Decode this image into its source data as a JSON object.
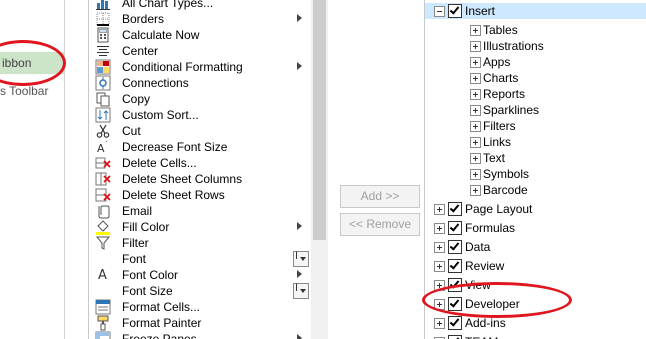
{
  "left_panel": {
    "ribbon_item": "ibbon",
    "toolbar_item": "s Toolbar"
  },
  "commands": [
    {
      "label": "All Chart Types...",
      "icon": "all-chart-types-icon",
      "arrow": false
    },
    {
      "label": "Borders",
      "icon": "borders-icon",
      "arrow": true
    },
    {
      "label": "Calculate Now",
      "icon": "calculator-icon",
      "arrow": false
    },
    {
      "label": "Center",
      "icon": "align-center-icon",
      "arrow": false
    },
    {
      "label": "Conditional Formatting",
      "icon": "conditional-formatting-icon",
      "arrow": true
    },
    {
      "label": "Connections",
      "icon": "connections-icon",
      "arrow": false
    },
    {
      "label": "Copy",
      "icon": "copy-icon",
      "arrow": false
    },
    {
      "label": "Custom Sort...",
      "icon": "custom-sort-icon",
      "arrow": false
    },
    {
      "label": "Cut",
      "icon": "scissors-icon",
      "arrow": false
    },
    {
      "label": "Decrease Font Size",
      "icon": "decrease-font-size-icon",
      "arrow": false
    },
    {
      "label": "Delete Cells...",
      "icon": "delete-cells-icon",
      "arrow": false
    },
    {
      "label": "Delete Sheet Columns",
      "icon": "delete-columns-icon",
      "arrow": false
    },
    {
      "label": "Delete Sheet Rows",
      "icon": "delete-rows-icon",
      "arrow": false
    },
    {
      "label": "Email",
      "icon": "email-icon",
      "arrow": false
    },
    {
      "label": "Fill Color",
      "icon": "fill-color-icon",
      "arrow": true
    },
    {
      "label": "Filter",
      "icon": "filter-icon",
      "arrow": false
    },
    {
      "label": "Font",
      "icon": "",
      "arrow": false,
      "split": true
    },
    {
      "label": "Font Color",
      "icon": "font-color-icon",
      "arrow": true
    },
    {
      "label": "Font Size",
      "icon": "",
      "arrow": false,
      "split": true
    },
    {
      "label": "Format Cells...",
      "icon": "format-cells-icon",
      "arrow": false
    },
    {
      "label": "Format Painter",
      "icon": "format-painter-icon",
      "arrow": false
    },
    {
      "label": "Freeze Panes",
      "icon": "freeze-panes-icon",
      "arrow": true
    }
  ],
  "split_glyph": "I",
  "buttons": {
    "add": "Add >>",
    "remove": "<< Remove"
  },
  "tree": [
    {
      "label": "Insert",
      "level": 0,
      "checkbox": true,
      "expander": "minus"
    },
    {
      "label": "Tables",
      "level": 1,
      "checkbox": false,
      "expander": "plus"
    },
    {
      "label": "Illustrations",
      "level": 1,
      "checkbox": false,
      "expander": "plus"
    },
    {
      "label": "Apps",
      "level": 1,
      "checkbox": false,
      "expander": "plus"
    },
    {
      "label": "Charts",
      "level": 1,
      "checkbox": false,
      "expander": "plus"
    },
    {
      "label": "Reports",
      "level": 1,
      "checkbox": false,
      "expander": "plus"
    },
    {
      "label": "Sparklines",
      "level": 1,
      "checkbox": false,
      "expander": "plus"
    },
    {
      "label": "Filters",
      "level": 1,
      "checkbox": false,
      "expander": "plus"
    },
    {
      "label": "Links",
      "level": 1,
      "checkbox": false,
      "expander": "plus"
    },
    {
      "label": "Text",
      "level": 1,
      "checkbox": false,
      "expander": "plus"
    },
    {
      "label": "Symbols",
      "level": 1,
      "checkbox": false,
      "expander": "plus"
    },
    {
      "label": "Barcode",
      "level": 1,
      "checkbox": false,
      "expander": "plus"
    },
    {
      "label": "Page Layout",
      "level": 0,
      "checkbox": true,
      "expander": "plus"
    },
    {
      "label": "Formulas",
      "level": 0,
      "checkbox": true,
      "expander": "plus"
    },
    {
      "label": "Data",
      "level": 0,
      "checkbox": true,
      "expander": "plus"
    },
    {
      "label": "Review",
      "level": 0,
      "checkbox": true,
      "expander": "plus"
    },
    {
      "label": "View",
      "level": 0,
      "checkbox": true,
      "expander": "plus"
    },
    {
      "label": "Developer",
      "level": 0,
      "checkbox": true,
      "expander": "plus"
    },
    {
      "label": "Add-ins",
      "level": 0,
      "checkbox": true,
      "expander": "plus"
    },
    {
      "label": "TEAM",
      "level": 0,
      "checkbox": true,
      "expander": "plus"
    }
  ],
  "colors": {
    "annotation": "#e0151d",
    "selection": "#cde8ff",
    "ribbon_highlight": "#cce4c7"
  }
}
